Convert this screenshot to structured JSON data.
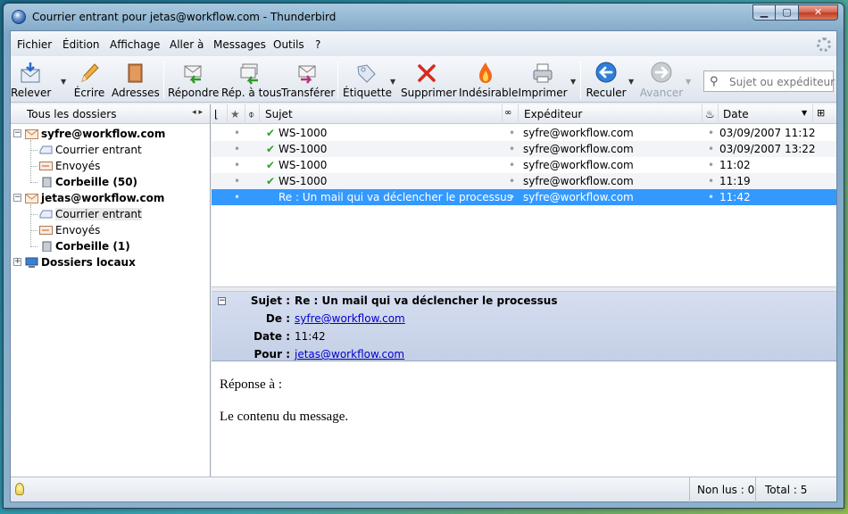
{
  "window": {
    "title": "Courrier entrant pour jetas@workflow.com - Thunderbird",
    "controls": {
      "minimize": "▁",
      "maximize": "▢",
      "close": "✕"
    }
  },
  "menu": [
    "Fichier",
    "Édition",
    "Affichage",
    "Aller à",
    "Messages",
    "Outils",
    "?"
  ],
  "toolbar": {
    "buttons": [
      {
        "label": "Relever",
        "icon": "get-mail-icon"
      },
      {
        "label": "Écrire",
        "icon": "pencil-icon"
      },
      {
        "label": "Adresses",
        "icon": "address-book-icon"
      },
      {
        "label": "Répondre",
        "icon": "reply-icon"
      },
      {
        "label": "Rép. à tous",
        "icon": "reply-all-icon"
      },
      {
        "label": "Transférer",
        "icon": "forward-icon"
      },
      {
        "label": "Étiquette",
        "icon": "tag-icon"
      },
      {
        "label": "Supprimer",
        "icon": "delete-icon"
      },
      {
        "label": "Indésirable",
        "icon": "junk-icon"
      },
      {
        "label": "Imprimer",
        "icon": "print-icon"
      },
      {
        "label": "Reculer",
        "icon": "back-icon"
      },
      {
        "label": "Avancer",
        "icon": "forward-arrow-icon"
      }
    ],
    "search_placeholder": "Sujet ou expéditeur"
  },
  "folder_pane": {
    "header": "Tous les dossiers",
    "nav_arrows": "◂ ▸",
    "accounts": [
      {
        "name": "syfre@workflow.com",
        "folders": [
          {
            "label": "Courrier entrant"
          },
          {
            "label": "Envoyés"
          },
          {
            "label": "Corbeille (50)"
          }
        ]
      },
      {
        "name": "jetas@workflow.com",
        "folders": [
          {
            "label": "Courrier entrant"
          },
          {
            "label": "Envoyés"
          },
          {
            "label": "Corbeille (1)"
          }
        ]
      },
      {
        "name": "Dossiers locaux",
        "folders": []
      }
    ]
  },
  "thread_pane": {
    "columns": {
      "subject": "Sujet",
      "sender": "Expéditeur",
      "date": "Date"
    },
    "messages": [
      {
        "subject": "WS-1000",
        "sender": "syfre@workflow.com",
        "date": "03/09/2007 11:12",
        "replied": true
      },
      {
        "subject": "WS-1000",
        "sender": "syfre@workflow.com",
        "date": "03/09/2007 13:22",
        "replied": true
      },
      {
        "subject": "WS-1000",
        "sender": "syfre@workflow.com",
        "date": "11:02",
        "replied": true
      },
      {
        "subject": "WS-1000",
        "sender": "syfre@workflow.com",
        "date": "11:19",
        "replied": true
      },
      {
        "subject": "Re : Un mail qui va déclencher le processus",
        "sender": "syfre@workflow.com",
        "date": "11:42",
        "replied": false
      }
    ]
  },
  "message_header": {
    "subject_label": "Sujet :",
    "subject": "Re : Un mail qui va déclencher le processus",
    "from_label": "De :",
    "from": "syfre@workflow.com",
    "date_label": "Date :",
    "date": "11:42",
    "to_label": "Pour :",
    "to": "jetas@workflow.com"
  },
  "message_body": {
    "line1": "Réponse à :",
    "line2": "Le contenu du message."
  },
  "status": {
    "unread": "Non lus : 0",
    "total": "Total : 5"
  },
  "colors": {
    "selection": "#3399ff",
    "header_bg": "#d6def0",
    "link": "#0000cc"
  }
}
